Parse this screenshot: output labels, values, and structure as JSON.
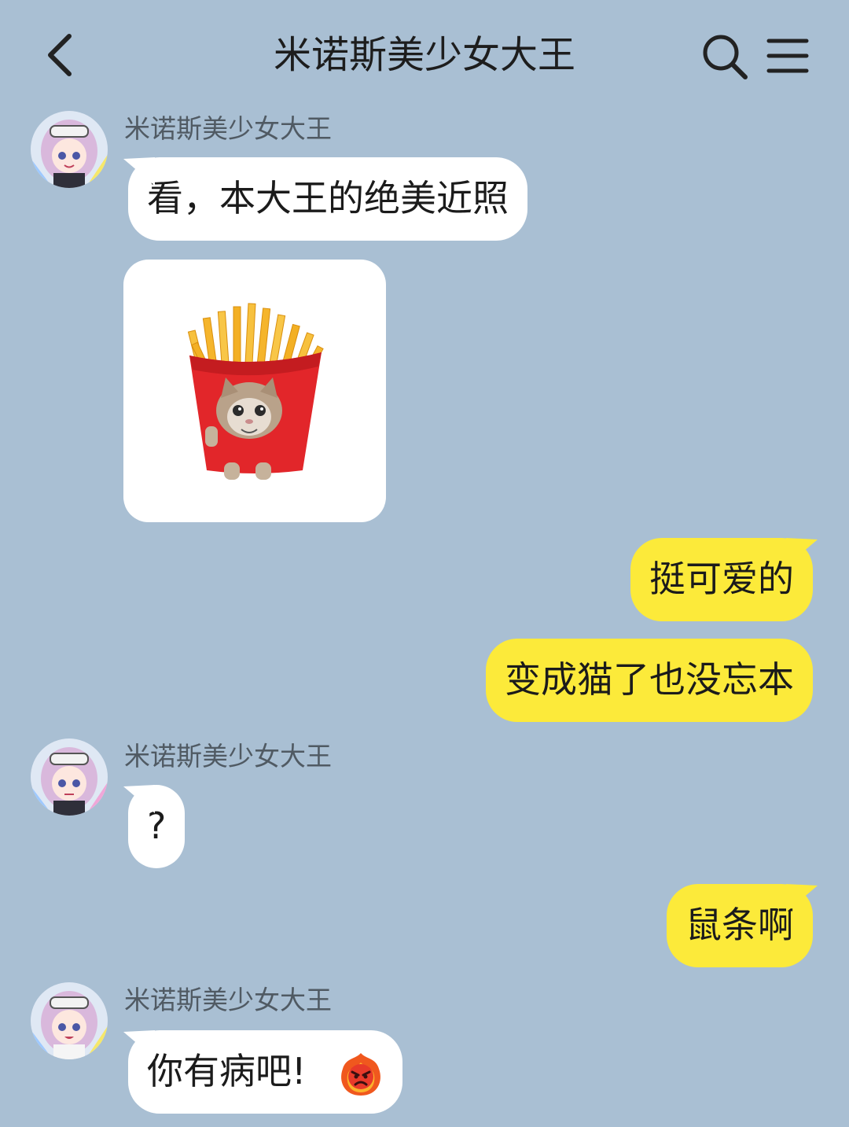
{
  "header": {
    "title": "米诺斯美少女大王",
    "back_icon": "chevron-left-icon",
    "search_icon": "search-icon",
    "menu_icon": "hamburger-menu-icon"
  },
  "colors": {
    "background": "#a9bfd3",
    "incoming_bubble": "#ffffff",
    "outgoing_bubble": "#fcea3a"
  },
  "messages": [
    {
      "sender": "米诺斯美少女大王",
      "direction": "incoming",
      "type": "text",
      "text": "看，本大王的绝美近照"
    },
    {
      "direction": "incoming",
      "type": "image",
      "image": "cat-in-french-fries-sticker"
    },
    {
      "direction": "outgoing",
      "type": "text",
      "text": "挺可爱的"
    },
    {
      "direction": "outgoing",
      "type": "text",
      "text": "变成猫了也没忘本"
    },
    {
      "sender": "米诺斯美少女大王",
      "direction": "incoming",
      "type": "text",
      "text": "?"
    },
    {
      "direction": "outgoing",
      "type": "text",
      "text": "鼠条啊"
    },
    {
      "sender": "米诺斯美少女大王",
      "direction": "incoming",
      "type": "text",
      "text": "你有病吧!",
      "emoji": "angry-fire-face-emoji"
    }
  ]
}
